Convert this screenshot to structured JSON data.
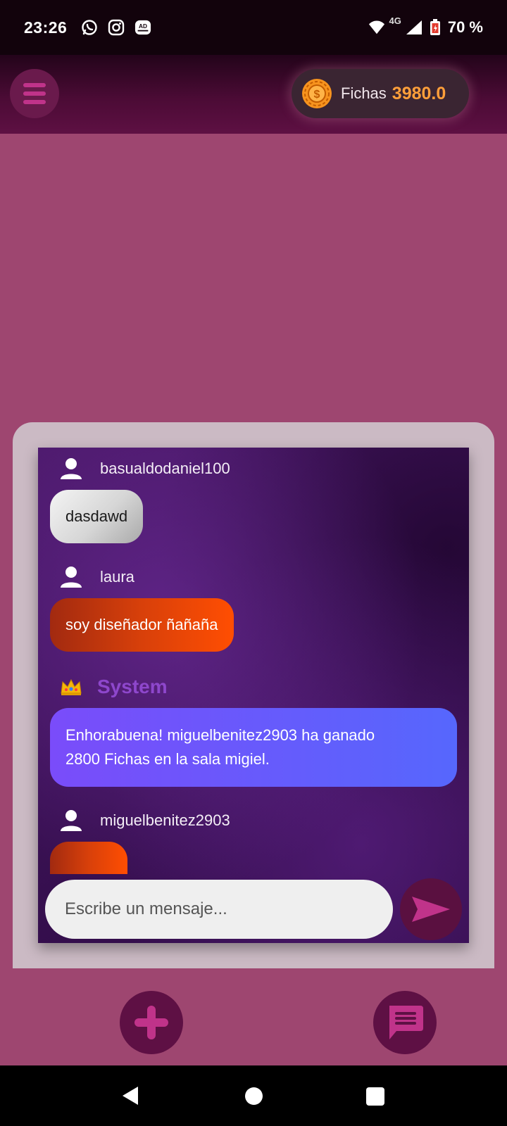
{
  "status_bar": {
    "time": "23:26",
    "network": "4G",
    "battery": "70 %",
    "notification_icons": [
      "whatsapp-icon",
      "instagram-icon",
      "ad-blocker-icon"
    ],
    "ad_blocker_badge": "AD"
  },
  "header": {
    "coins_label": "Fichas",
    "coins_value": "3980.0"
  },
  "chat": {
    "messages": [
      {
        "author": "basualdodaniel100",
        "text": "dasdawd",
        "style": "gray"
      },
      {
        "author": "laura",
        "text": "soy diseñador ñañaña",
        "style": "orange"
      },
      {
        "author": "System",
        "text_line1": "Enhorabuena! miguelbenitez2903 ha ganado",
        "text_line2": "2800 Fichas en la sala migiel.",
        "style": "system"
      },
      {
        "author": "miguelbenitez2903",
        "style": "orange"
      }
    ],
    "input_placeholder": "Escribe un mensaje..."
  },
  "colors": {
    "background": "#9e4670",
    "accent": "#c0338a",
    "coins": "#ff9f3a",
    "system_name": "#8e47cc"
  }
}
